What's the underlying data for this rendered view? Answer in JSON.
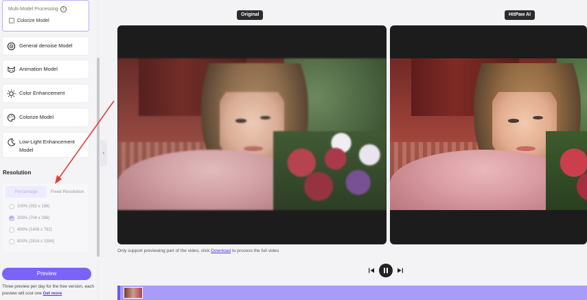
{
  "sidebar": {
    "multi_model": {
      "title": "Multi-Model Processing",
      "checkbox_label": "Colorize Model"
    },
    "models": [
      {
        "label": "General denoise Model",
        "icon": "denoise-icon"
      },
      {
        "label": "Animation Model",
        "icon": "animation-face-icon"
      },
      {
        "label": "Color Enhancement",
        "icon": "sun-icon"
      },
      {
        "label": "Colorize Model",
        "icon": "palette-icon"
      },
      {
        "label": "Low-Light Enhancement Model",
        "icon": "moon-icon"
      }
    ],
    "resolution": {
      "title": "Resolution",
      "tabs": [
        "Percentage",
        "Fixed Resolution"
      ],
      "options": [
        {
          "label": "100% (352 x 198)",
          "checked": false
        },
        {
          "label": "200% (704 x 396)",
          "checked": true
        },
        {
          "label": "400% (1408 x 792)",
          "checked": false
        },
        {
          "label": "800% (2816 x 1584)",
          "checked": false
        }
      ]
    },
    "preview_button": "Preview",
    "note_text": "Three preview per day for the free version, each preview will cost one",
    "note_link": "Get more"
  },
  "main": {
    "original_tag": "Original",
    "enhanced_tag": "HitPaw AI",
    "hint_prefix": "Only support previewing part of the video, click",
    "hint_link": "Download",
    "hint_suffix": "to process the full video"
  },
  "colors": {
    "accent": "#7b63f7",
    "selection_border": "#b9a9ff",
    "timeline": "#a99cf8",
    "annotation_arrow": "#e53935"
  }
}
